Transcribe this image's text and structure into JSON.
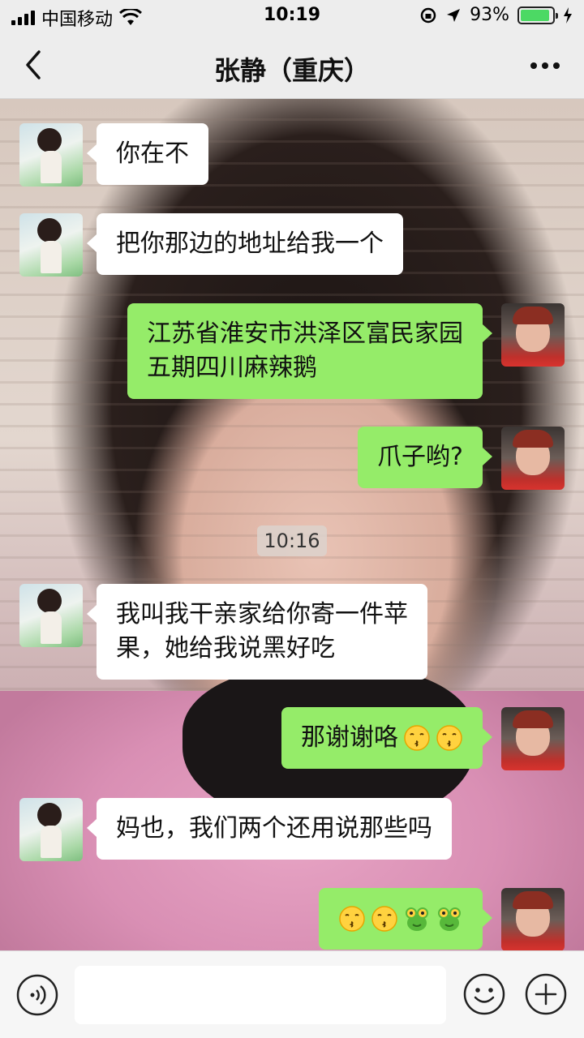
{
  "status_bar": {
    "carrier": "中国移动",
    "time": "10:19",
    "battery_percent": "93%",
    "battery_level": 0.93
  },
  "nav": {
    "title": "张静（重庆）",
    "back_icon": "chevron-left-icon",
    "more_icon": "more-dots-icon"
  },
  "messages": [
    {
      "sender": "friend",
      "text": "你在不"
    },
    {
      "sender": "friend",
      "text": "把你那边的地址给我一个"
    },
    {
      "sender": "me",
      "line1": "江苏省淮安市洪泽区富民家园",
      "line2": "五期四川麻辣鹅"
    },
    {
      "sender": "me",
      "text": "爪子哟?"
    },
    {
      "sender": "system",
      "text": "10:16"
    },
    {
      "sender": "friend",
      "line1": "我叫我干亲家给你寄一件苹",
      "line2": "果，她给我说黑好吃"
    },
    {
      "sender": "me",
      "text": "那谢谢咯",
      "emojis": [
        "kissing-face",
        "kissing-face"
      ]
    },
    {
      "sender": "friend",
      "text": "妈也，我们两个还用说那些吗"
    },
    {
      "sender": "me",
      "emojis": [
        "kissing-face",
        "kissing-face",
        "frog-face",
        "frog-face"
      ]
    }
  ],
  "input_bar": {
    "voice_icon": "voice-icon",
    "emoji_icon": "smiley-icon",
    "plus_icon": "plus-icon",
    "text_value": ""
  },
  "colors": {
    "my_bubble": "#95ec69",
    "friend_bubble": "#ffffff",
    "bar_bg": "#ededed",
    "battery_fill": "#4cd964"
  }
}
